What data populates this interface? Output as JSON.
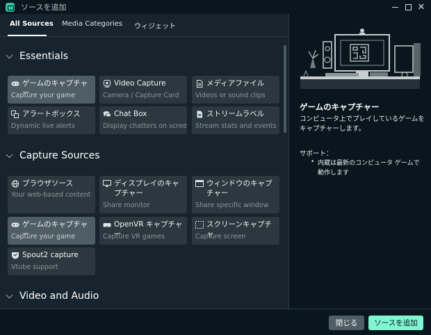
{
  "window": {
    "title": "ソースを追加"
  },
  "tabs": [
    {
      "label": "All Sources"
    },
    {
      "label": "Media Categories"
    },
    {
      "label": "ウィジェット"
    }
  ],
  "sections": [
    {
      "title": "Essentials",
      "items": [
        {
          "name": "ゲームのキャプチャー",
          "desc": "Capture your game",
          "icon": "gamepad-icon"
        },
        {
          "name": "Video Capture",
          "desc": "Camera / Capture Card",
          "icon": "webcam-icon"
        },
        {
          "name": "メディアファイル",
          "desc": "Videos or sound clips",
          "icon": "file-icon"
        },
        {
          "name": "アラートボックス",
          "desc": "Dynamic live alerts",
          "icon": "alert-box-icon"
        },
        {
          "name": "Chat Box",
          "desc": "Display chatters on screen",
          "icon": "chat-icon"
        },
        {
          "name": "ストリームラベル",
          "desc": "Stream stats and events",
          "icon": "label-icon"
        }
      ]
    },
    {
      "title": "Capture Sources",
      "items": [
        {
          "name": "ブラウザソース",
          "desc": "Your web-based content",
          "icon": "globe-icon"
        },
        {
          "name": "ディスプレイのキャプチャー",
          "desc": "Share monitor",
          "icon": "monitor-icon"
        },
        {
          "name": "ウィンドウのキャプチャー",
          "desc": "Share specific window",
          "icon": "window-icon"
        },
        {
          "name": "ゲームのキャプチャー",
          "desc": "Capture your game",
          "icon": "gamepad-icon"
        },
        {
          "name": "OpenVR キャプチャー",
          "desc": "Capture VR games",
          "icon": "vr-headset-icon"
        },
        {
          "name": "スクリーンキャプチャ",
          "desc": "Capture screen",
          "icon": "screen-capture-icon"
        },
        {
          "name": "Spout2 capture",
          "desc": "Vtube support",
          "icon": "spout-icon"
        }
      ]
    },
    {
      "title": "Video and Audio"
    }
  ],
  "preview": {
    "title": "ゲームのキャプチャー",
    "description": "コンピュータ上でプレイしているゲームをキャプチャーします。",
    "support_label": "サポート：",
    "support_items": [
      "内蔵は最新のコンピュータ ゲームで動作します"
    ]
  },
  "buttons": {
    "close": "閉じる",
    "add": "ソースを追加"
  },
  "colors": {
    "accent": "#80f5d2",
    "background": "#17242d",
    "panel": "#09161d",
    "card": "#2b383f",
    "card_selected": "#4f5e65"
  }
}
